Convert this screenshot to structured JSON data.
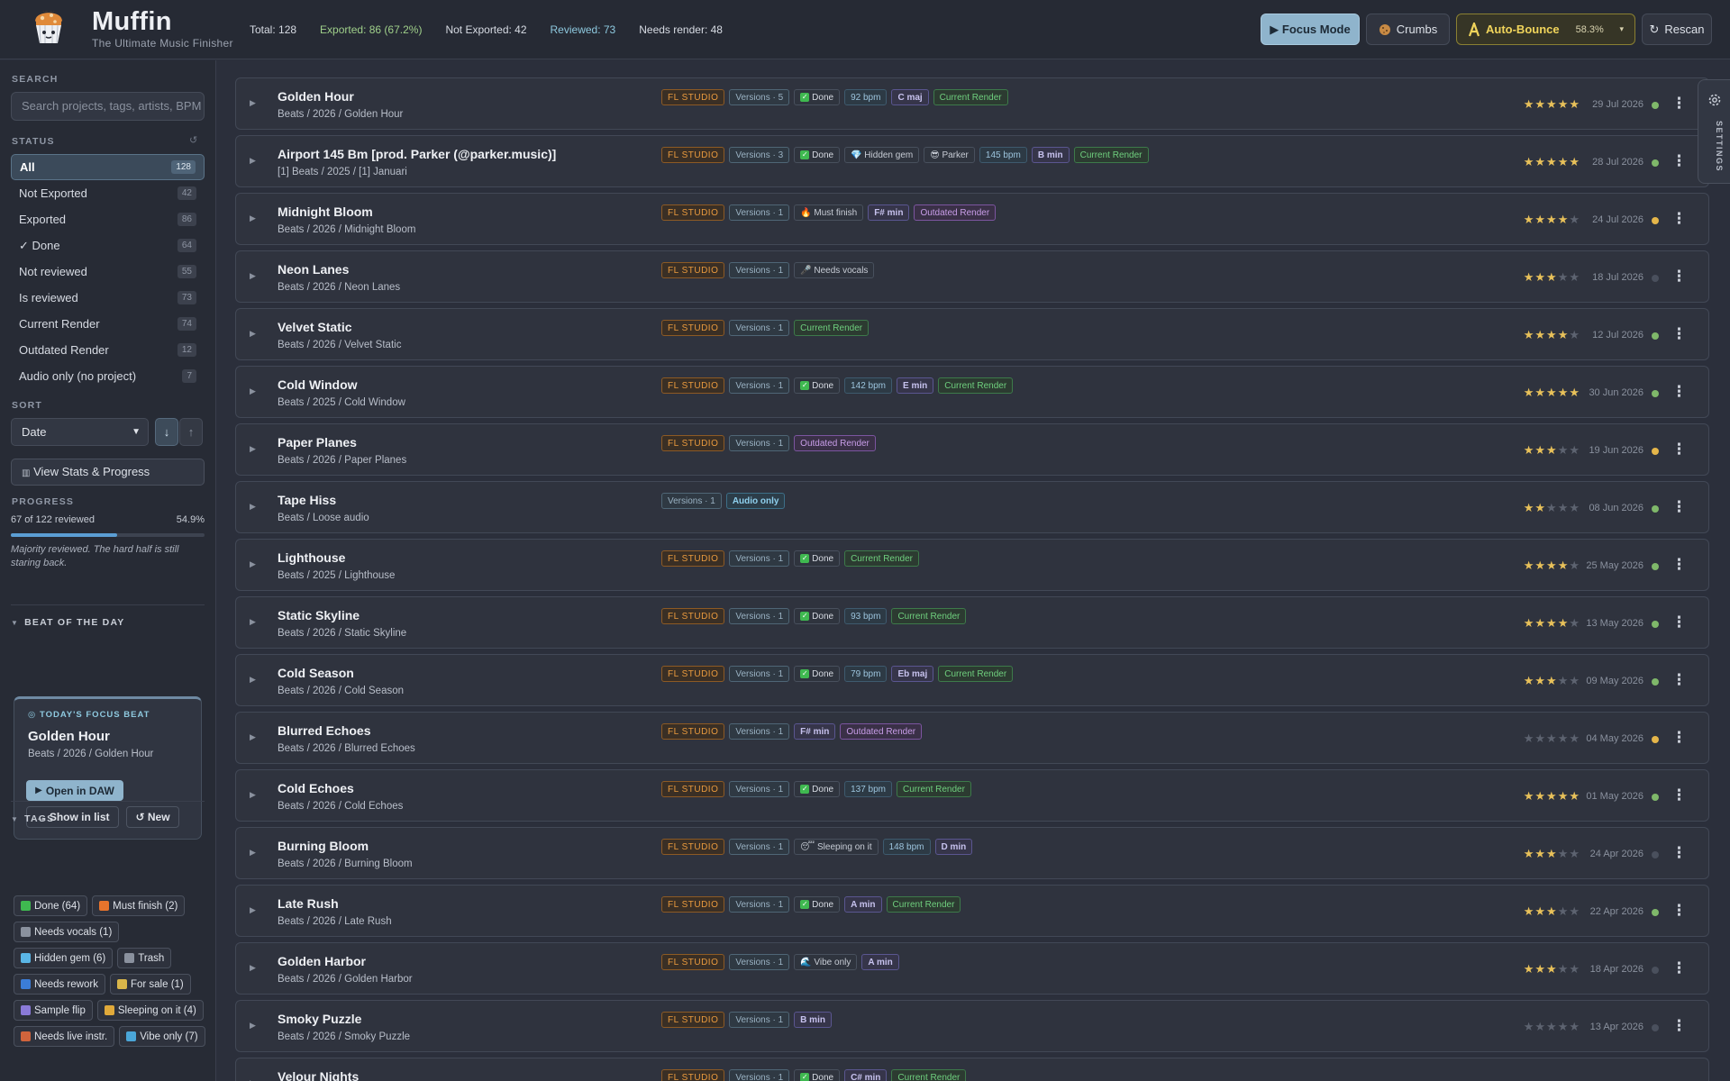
{
  "app": {
    "name": "Muffin",
    "tagline": "The Ultimate Music Finisher"
  },
  "header_stats": {
    "total": "Total: 128",
    "exported": "Exported: 86 (67.2%)",
    "not_exported": "Not Exported: 42",
    "reviewed": "Reviewed: 73",
    "needs_render": "Needs render: 48"
  },
  "header_buttons": {
    "focus": "▶ Focus Mode",
    "crumbs": "Crumbs",
    "auto_bounce": "Auto-Bounce",
    "auto_bounce_pct": "58.3%",
    "rescan": "Rescan"
  },
  "sidebar": {
    "search_label": "SEARCH",
    "search_placeholder": "Search projects, tags, artists, BPM",
    "status_label": "STATUS",
    "status_items": [
      {
        "label": "All",
        "count": "128"
      },
      {
        "label": "Not Exported",
        "count": "42"
      },
      {
        "label": "Exported",
        "count": "86"
      },
      {
        "label": "✓ Done",
        "count": "64"
      },
      {
        "label": "Not reviewed",
        "count": "55"
      },
      {
        "label": "Is reviewed",
        "count": "73"
      },
      {
        "label": "Current Render",
        "count": "74"
      },
      {
        "label": "Outdated Render",
        "count": "12"
      },
      {
        "label": "Audio only (no project)",
        "count": "7"
      }
    ],
    "sort_label": "SORT",
    "sort_value": "Date",
    "stats_button": "View Stats & Progress",
    "progress_label": "PROGRESS",
    "progress_text": "67 of 122 reviewed",
    "progress_pct": "54.9%",
    "progress_fraction": 0.549,
    "progress_note": "Majority reviewed. The hard half is still staring back.",
    "botd_header": "BEAT OF THE DAY",
    "botd_label": "TODAY'S FOCUS BEAT",
    "botd_title": "Golden Hour",
    "botd_path": "Beats / 2026 / Golden Hour",
    "botd_open": "Open in DAW",
    "botd_show": "→ Show in list",
    "botd_new": "↺ New",
    "tags_header": "TAGS",
    "tags": [
      {
        "label": "Done (64)",
        "color": "#3fb950",
        "icon": "check-icon"
      },
      {
        "label": "Must finish (2)",
        "color": "#e8742c",
        "icon": "fire-icon"
      },
      {
        "label": "Needs vocals (1)",
        "color": "#8a919e",
        "icon": "mic-icon"
      },
      {
        "label": "Hidden gem (6)",
        "color": "#5ab6e6",
        "icon": "gem-icon"
      },
      {
        "label": "Trash",
        "color": "#8a919e",
        "icon": "trash-icon"
      },
      {
        "label": "Needs rework",
        "color": "#3b7dd8",
        "icon": "rework-icon"
      },
      {
        "label": "For sale (1)",
        "color": "#d9b64a",
        "icon": "money-icon"
      },
      {
        "label": "Sample flip",
        "color": "#8a7ad8",
        "icon": "headphones-icon"
      },
      {
        "label": "Sleeping on it (4)",
        "color": "#e0a93a",
        "icon": "sleep-icon"
      },
      {
        "label": "Needs live instr.",
        "color": "#d0643c",
        "icon": "guitar-icon"
      },
      {
        "label": "Vibe only (7)",
        "color": "#4aa6d8",
        "icon": "wave-icon"
      }
    ]
  },
  "projects": [
    {
      "title": "Golden Hour",
      "path": "Beats / 2026 / Golden Hour",
      "chips": [
        [
          "fl",
          "FL STUDIO"
        ],
        [
          "ver",
          "Versions · 5"
        ],
        [
          "done",
          "Done"
        ],
        [
          "bpm",
          "92 bpm"
        ],
        [
          "key",
          "C maj"
        ],
        [
          "cur",
          "Current Render"
        ]
      ],
      "rating": 5,
      "date": "29 Jul 2026",
      "dot": "#7fb86a"
    },
    {
      "title": "Airport 145 Bm [prod. Parker (@parker.music)]",
      "path": "[1] Beats / 2025 / [1] Januari",
      "chips": [
        [
          "fl",
          "FL STUDIO"
        ],
        [
          "ver",
          "Versions · 3"
        ],
        [
          "done",
          "Done"
        ],
        [
          "tag",
          "💎 Hidden gem"
        ],
        [
          "tag",
          "😎 Parker"
        ],
        [
          "bpm",
          "145 bpm"
        ],
        [
          "key",
          "B min"
        ],
        [
          "cur",
          "Current Render"
        ]
      ],
      "rating": 5,
      "date": "28 Jul 2026",
      "dot": "#7fb86a"
    },
    {
      "title": "Midnight Bloom",
      "path": "Beats / 2026 / Midnight Bloom",
      "chips": [
        [
          "fl",
          "FL STUDIO"
        ],
        [
          "ver",
          "Versions · 1"
        ],
        [
          "tag",
          "🔥 Must finish"
        ],
        [
          "key",
          "F# min"
        ],
        [
          "out",
          "Outdated Render"
        ]
      ],
      "rating": 4,
      "date": "24 Jul 2026",
      "dot": "#e5b64a"
    },
    {
      "title": "Neon Lanes",
      "path": "Beats / 2026 / Neon Lanes",
      "chips": [
        [
          "fl",
          "FL STUDIO"
        ],
        [
          "ver",
          "Versions · 1"
        ],
        [
          "tag",
          "🎤 Needs vocals"
        ]
      ],
      "rating": 3,
      "date": "18 Jul 2026",
      "dot": "#4a505d"
    },
    {
      "title": "Velvet Static",
      "path": "Beats / 2026 / Velvet Static",
      "chips": [
        [
          "fl",
          "FL STUDIO"
        ],
        [
          "ver",
          "Versions · 1"
        ],
        [
          "cur",
          "Current Render"
        ]
      ],
      "rating": 4,
      "date": "12 Jul 2026",
      "dot": "#7fb86a"
    },
    {
      "title": "Cold Window",
      "path": "Beats / 2025 / Cold Window",
      "chips": [
        [
          "fl",
          "FL STUDIO"
        ],
        [
          "ver",
          "Versions · 1"
        ],
        [
          "done",
          "Done"
        ],
        [
          "bpm",
          "142 bpm"
        ],
        [
          "key",
          "E min"
        ],
        [
          "cur",
          "Current Render"
        ]
      ],
      "rating": 5,
      "date": "30 Jun 2026",
      "dot": "#7fb86a"
    },
    {
      "title": "Paper Planes",
      "path": "Beats / 2026 / Paper Planes",
      "chips": [
        [
          "fl",
          "FL STUDIO"
        ],
        [
          "ver",
          "Versions · 1"
        ],
        [
          "out",
          "Outdated Render"
        ]
      ],
      "rating": 3,
      "date": "19 Jun 2026",
      "dot": "#e5b64a"
    },
    {
      "title": "Tape Hiss",
      "path": "Beats / Loose audio",
      "chips": [
        [
          "ver",
          "Versions · 1"
        ],
        [
          "aud",
          "Audio only"
        ]
      ],
      "rating": 2,
      "date": "08 Jun 2026",
      "dot": "#7fb86a"
    },
    {
      "title": "Lighthouse",
      "path": "Beats / 2025 / Lighthouse",
      "chips": [
        [
          "fl",
          "FL STUDIO"
        ],
        [
          "ver",
          "Versions · 1"
        ],
        [
          "done",
          "Done"
        ],
        [
          "cur",
          "Current Render"
        ]
      ],
      "rating": 4,
      "date": "25 May 2026",
      "dot": "#7fb86a"
    },
    {
      "title": "Static Skyline",
      "path": "Beats / 2026 / Static Skyline",
      "chips": [
        [
          "fl",
          "FL STUDIO"
        ],
        [
          "ver",
          "Versions · 1"
        ],
        [
          "done",
          "Done"
        ],
        [
          "bpm",
          "93 bpm"
        ],
        [
          "cur",
          "Current Render"
        ]
      ],
      "rating": 4,
      "date": "13 May 2026",
      "dot": "#7fb86a"
    },
    {
      "title": "Cold Season",
      "path": "Beats / 2026 / Cold Season",
      "chips": [
        [
          "fl",
          "FL STUDIO"
        ],
        [
          "ver",
          "Versions · 1"
        ],
        [
          "done",
          "Done"
        ],
        [
          "bpm",
          "79 bpm"
        ],
        [
          "key",
          "Eb maj"
        ],
        [
          "cur",
          "Current Render"
        ]
      ],
      "rating": 3,
      "date": "09 May 2026",
      "dot": "#7fb86a"
    },
    {
      "title": "Blurred Echoes",
      "path": "Beats / 2026 / Blurred Echoes",
      "chips": [
        [
          "fl",
          "FL STUDIO"
        ],
        [
          "ver",
          "Versions · 1"
        ],
        [
          "key",
          "F# min"
        ],
        [
          "out",
          "Outdated Render"
        ]
      ],
      "rating": 0,
      "date": "04 May 2026",
      "dot": "#e5b64a"
    },
    {
      "title": "Cold Echoes",
      "path": "Beats / 2026 / Cold Echoes",
      "chips": [
        [
          "fl",
          "FL STUDIO"
        ],
        [
          "ver",
          "Versions · 1"
        ],
        [
          "done",
          "Done"
        ],
        [
          "bpm",
          "137 bpm"
        ],
        [
          "cur",
          "Current Render"
        ]
      ],
      "rating": 5,
      "date": "01 May 2026",
      "dot": "#7fb86a"
    },
    {
      "title": "Burning Bloom",
      "path": "Beats / 2026 / Burning Bloom",
      "chips": [
        [
          "fl",
          "FL STUDIO"
        ],
        [
          "ver",
          "Versions · 1"
        ],
        [
          "tag",
          "😴 Sleeping on it"
        ],
        [
          "bpm",
          "148 bpm"
        ],
        [
          "key",
          "D min"
        ]
      ],
      "rating": 3,
      "date": "24 Apr 2026",
      "dot": "#4a505d"
    },
    {
      "title": "Late Rush",
      "path": "Beats / 2026 / Late Rush",
      "chips": [
        [
          "fl",
          "FL STUDIO"
        ],
        [
          "ver",
          "Versions · 1"
        ],
        [
          "done",
          "Done"
        ],
        [
          "key",
          "A min"
        ],
        [
          "cur",
          "Current Render"
        ]
      ],
      "rating": 3,
      "date": "22 Apr 2026",
      "dot": "#7fb86a"
    },
    {
      "title": "Golden Harbor",
      "path": "Beats / 2026 / Golden Harbor",
      "chips": [
        [
          "fl",
          "FL STUDIO"
        ],
        [
          "ver",
          "Versions · 1"
        ],
        [
          "tag",
          "🌊 Vibe only"
        ],
        [
          "key",
          "A min"
        ]
      ],
      "rating": 3,
      "date": "18 Apr 2026",
      "dot": "#4a505d"
    },
    {
      "title": "Smoky Puzzle",
      "path": "Beats / 2026 / Smoky Puzzle",
      "chips": [
        [
          "fl",
          "FL STUDIO"
        ],
        [
          "ver",
          "Versions · 1"
        ],
        [
          "key",
          "B min"
        ]
      ],
      "rating": 0,
      "date": "13 Apr 2026",
      "dot": "#4a505d"
    },
    {
      "title": "Velour Nights",
      "path": "",
      "chips": [
        [
          "fl",
          "FL STUDIO"
        ],
        [
          "ver",
          "Versions · 1"
        ],
        [
          "done",
          "Done"
        ],
        [
          "key",
          "C# min"
        ],
        [
          "cur",
          "Current Render"
        ]
      ],
      "rating": 0,
      "date": "",
      "dot": ""
    }
  ],
  "settings_tab": "SETTINGS"
}
